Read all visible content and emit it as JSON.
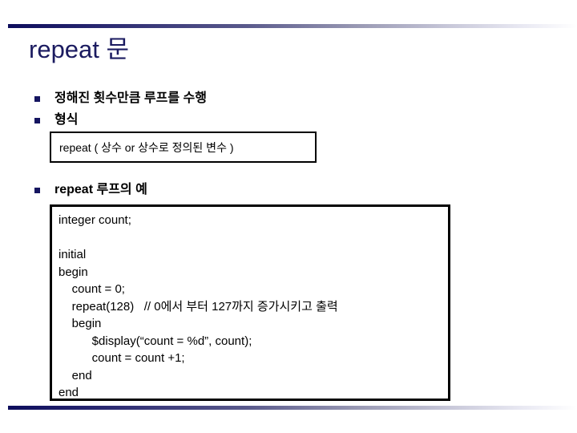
{
  "slide": {
    "title": "repeat 문",
    "accent_color": "#1b1b60",
    "bullet_marker_color": "#151560",
    "rule_gradient_start": "#0d0d5c",
    "rule_gradient_end": "#ffffff"
  },
  "bullets": [
    {
      "label": "정해진 횟수만큼 루프를 수행"
    },
    {
      "label": "형식"
    },
    {
      "label": "repeat 루프의 예"
    }
  ],
  "format_box": {
    "text": "repeat ( 상수 or 상수로 정의된 변수 )"
  },
  "code_box": {
    "lines": [
      "integer count;",
      "",
      "initial",
      "begin",
      "    count = 0;",
      "    repeat(128)   // 0에서 부터 127까지 증가시키고 출력",
      "    begin",
      "          $display(“count = %d”, count);",
      "          count = count +1;",
      "    end",
      "end"
    ]
  }
}
